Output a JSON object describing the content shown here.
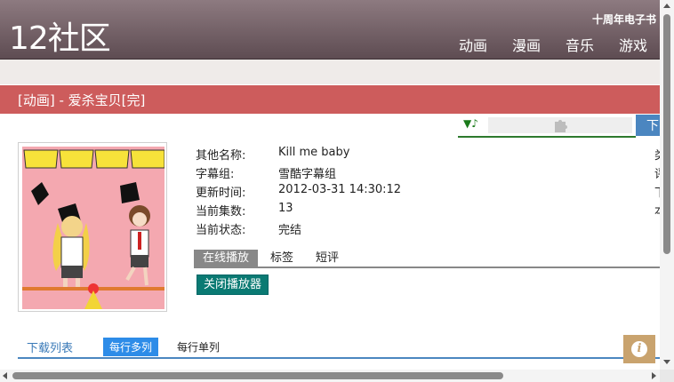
{
  "header": {
    "logo": "12社区",
    "festival": "十周年电子书",
    "nav": [
      "动画",
      "漫画",
      "音乐",
      "游戏"
    ]
  },
  "title_bar": "[动画] - 爱杀宝贝[完]",
  "player": {
    "note": "▼♪",
    "download_label": "下"
  },
  "info": [
    {
      "label": "其他名称:",
      "value": "Kill me baby"
    },
    {
      "label": "字幕组:",
      "value": "雪酷字幕组"
    },
    {
      "label": "更新时间:",
      "value": "2012-03-31 14:30:12"
    },
    {
      "label": "当前集数:",
      "value": "13"
    },
    {
      "label": "当前状态:",
      "value": "完结"
    }
  ],
  "right_letters": [
    "类",
    "评",
    "下",
    "本"
  ],
  "tabs": [
    "在线播放",
    "标签",
    "短评"
  ],
  "close_player": "关闭播放器",
  "download": {
    "title": "下载列表",
    "multi": "每行多列",
    "single": "每行单列"
  },
  "info_button": "i",
  "colors": {
    "title_bar": "#cd5c5c",
    "download_button": "#4b86c0",
    "close_player": "#0a7a73",
    "multi_button": "#2d8ce8"
  }
}
